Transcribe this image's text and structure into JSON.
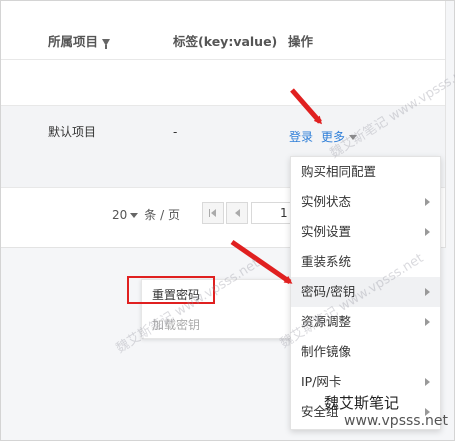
{
  "table": {
    "headers": {
      "project": "所属项目",
      "tags": "标签(key:value)",
      "operations": "操作"
    },
    "row": {
      "project": "默认项目",
      "tags": "-",
      "login": "登录",
      "more": "更多"
    }
  },
  "pagination": {
    "page_size": "20",
    "page_size_unit": "条 / 页",
    "current_page": "1"
  },
  "more_menu": {
    "items": [
      {
        "label": "购买相同配置",
        "has_submenu": false
      },
      {
        "label": "实例状态",
        "has_submenu": true
      },
      {
        "label": "实例设置",
        "has_submenu": true
      },
      {
        "label": "重装系统",
        "has_submenu": false
      },
      {
        "label": "密码/密钥",
        "has_submenu": true
      },
      {
        "label": "资源调整",
        "has_submenu": true
      },
      {
        "label": "制作镜像",
        "has_submenu": false
      },
      {
        "label": "IP/网卡",
        "has_submenu": true
      },
      {
        "label": "安全组",
        "has_submenu": true
      }
    ]
  },
  "password_submenu": {
    "reset_password": "重置密码",
    "load_key": "加载密钥"
  },
  "watermark": {
    "text": "魏艾斯笔记",
    "url": "www.vpsss.net",
    "diagonal": "魏艾斯笔记 www.vpsss.net"
  },
  "colors": {
    "link": "#2f7fd8",
    "annotation_red": "#e02020",
    "hover_bg": "#f0f1f3"
  }
}
